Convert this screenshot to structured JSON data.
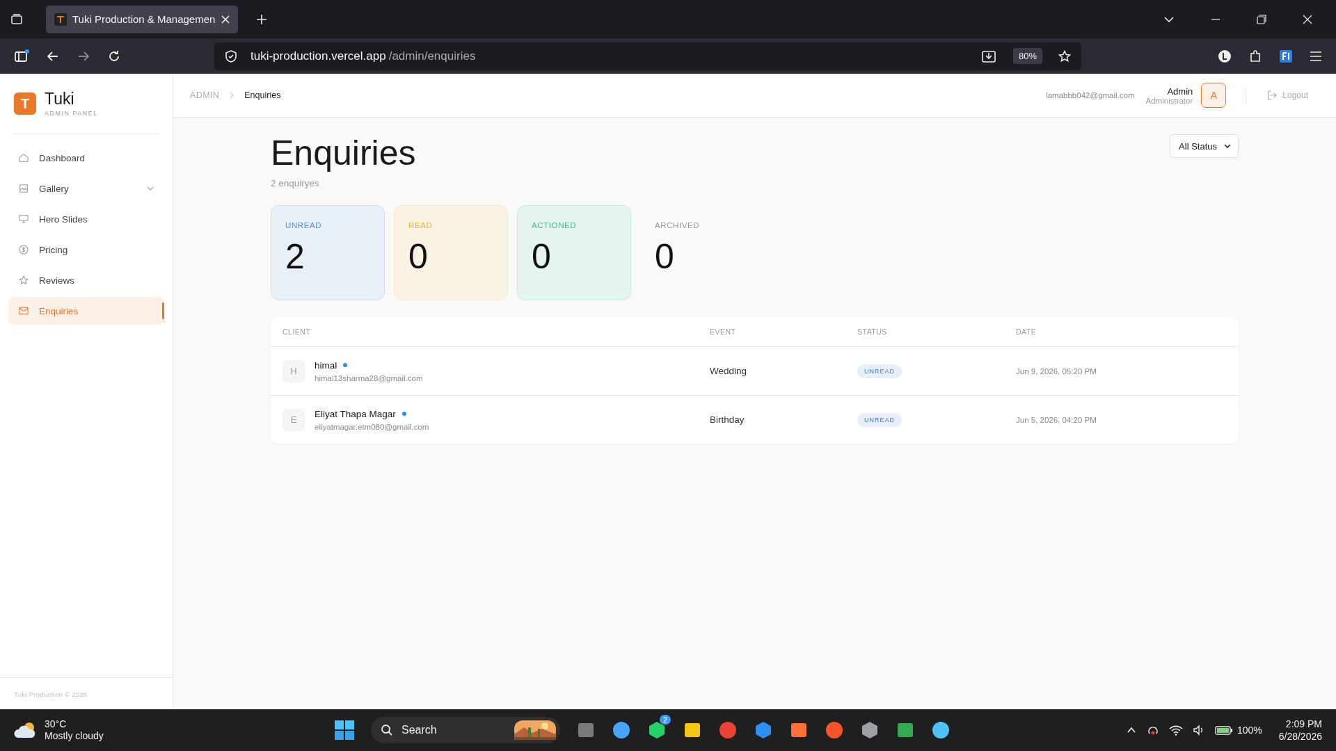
{
  "browser": {
    "tabs": [
      {
        "title": "Tuki Production & Managemen",
        "selected": true
      }
    ],
    "url_host": "tuki-production.vercel.app",
    "url_path": "/admin/enquiries",
    "zoom": "80%"
  },
  "sidebar": {
    "brand": {
      "logo_letter": "T",
      "name": "Tuki",
      "subtitle": "ADMIN PANEL"
    },
    "items": [
      {
        "label": "Dashboard",
        "kind": "link",
        "selected": false
      },
      {
        "label": "Gallery",
        "kind": "group",
        "selected": false,
        "expanded": false
      },
      {
        "label": "Hero Slides",
        "kind": "link",
        "selected": false
      },
      {
        "label": "Pricing",
        "kind": "link",
        "selected": false
      },
      {
        "label": "Reviews",
        "kind": "link",
        "selected": false
      },
      {
        "label": "Enquiries",
        "kind": "link",
        "selected": true
      }
    ],
    "footer": "Tuki Production © 2026"
  },
  "header": {
    "breadcrumb": [
      "ADMIN",
      "Enquiries"
    ],
    "email": "lamabbb042@gmail.com",
    "user_name": "Admin",
    "user_role": "Administrator",
    "avatar_letter": "A",
    "logout": "Logout"
  },
  "page": {
    "title": "Enquiries",
    "count": "2 enquiryes",
    "filter": "All Status",
    "stats": [
      {
        "label": "UNREAD",
        "value": "2",
        "kind": "card",
        "color": "#5b8fd6"
      },
      {
        "label": "READ",
        "value": "0",
        "kind": "card",
        "color": "#f0b030"
      },
      {
        "label": "ACTIONED",
        "value": "0",
        "kind": "card",
        "color": "#3cbf90"
      },
      {
        "label": "ARCHIVED",
        "value": "0",
        "kind": "plain",
        "color": "#9a9a9a"
      }
    ],
    "table": {
      "columns": [
        "CLIENT",
        "EVENT",
        "STATUS",
        "DATE"
      ],
      "rows": [
        {
          "initial": "H",
          "name": "himal",
          "unread": true,
          "email": "himal13sharma28@gmail.com",
          "event": "Wedding",
          "status": "UNREAD",
          "date": "Jun 9, 2026, 05:20 PM"
        },
        {
          "initial": "E",
          "name": "Eliyat Thapa Magar",
          "unread": true,
          "email": "eliyatmagar.etm080@gmail.com",
          "event": "Birthday",
          "status": "UNREAD",
          "date": "Jun 5, 2026, 04:20 PM"
        }
      ]
    }
  },
  "taskbar": {
    "temperature": "30°C",
    "weather": "Mostly cloudy",
    "search_placeholder": "Search",
    "chat_badge": "2",
    "battery": "100%",
    "time": "2:09 PM",
    "date": "6/28/2026"
  }
}
